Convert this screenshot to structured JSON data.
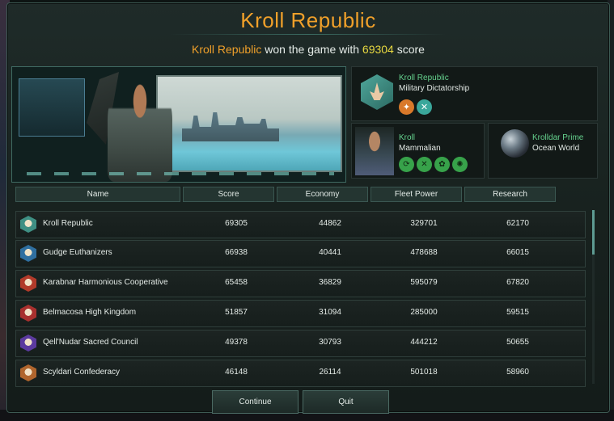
{
  "title": "Kroll Republic",
  "subtitle": {
    "winner": "Kroll Republic",
    "mid": " won the game with ",
    "score": "69304",
    "end": " score"
  },
  "empire": {
    "name": "Kroll Republic",
    "government": "Military Dictatorship",
    "flag_icon": "crystal-flag-icon",
    "ethics_icons": [
      "militarist-icon",
      "xenophile-icon"
    ]
  },
  "species": {
    "name": "Kroll",
    "class": "Mammalian",
    "trait_icons": [
      "adaptive-icon",
      "industrious-icon",
      "agrarian-icon",
      "resilient-icon"
    ]
  },
  "planet": {
    "name": "Krolldar Prime",
    "class": "Ocean World"
  },
  "table": {
    "headers": [
      "Name",
      "Score",
      "Economy",
      "Fleet Power",
      "Research"
    ],
    "rows": [
      {
        "name": "Kroll Republic",
        "score": "69305",
        "economy": "44862",
        "fleet": "329701",
        "research": "62170",
        "flag_color": "#3e8f83"
      },
      {
        "name": "Gudge Euthanizers",
        "score": "66938",
        "economy": "40441",
        "fleet": "478688",
        "research": "66015",
        "flag_color": "#2f6fa0"
      },
      {
        "name": "Karabnar Harmonious Cooperative",
        "score": "65458",
        "economy": "36829",
        "fleet": "595079",
        "research": "67820",
        "flag_color": "#b13a2a"
      },
      {
        "name": "Belmacosa High Kingdom",
        "score": "51857",
        "economy": "31094",
        "fleet": "285000",
        "research": "59515",
        "flag_color": "#a8302e"
      },
      {
        "name": "Qell'Nudar Sacred Council",
        "score": "49378",
        "economy": "30793",
        "fleet": "444212",
        "research": "50655",
        "flag_color": "#5b3a9e"
      },
      {
        "name": "Scyldari Confederacy",
        "score": "46148",
        "economy": "26114",
        "fleet": "501018",
        "research": "58960",
        "flag_color": "#b0652d"
      }
    ]
  },
  "buttons": {
    "continue": "Continue",
    "quit": "Quit"
  }
}
